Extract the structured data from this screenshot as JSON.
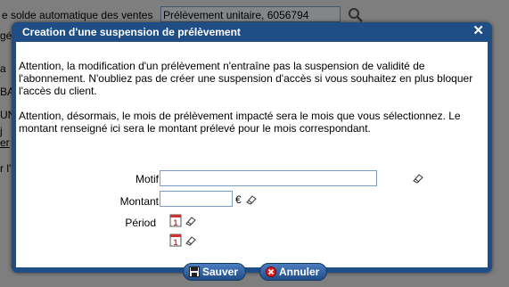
{
  "background": {
    "top_label": "e solde automatique des ventes",
    "top_field_value": "Prélèvement unitaire, 6056794",
    "fragments": [
      "gé",
      "a",
      "BAN",
      "UN",
      "j",
      "er",
      "r l'"
    ]
  },
  "dialog": {
    "title": "Creation d'une suspension de prélèvement",
    "close_label": "✕",
    "paragraph1": "Attention, la modification d'un prélèvement n'entraîne pas la suspension de validité de l'abonnement. N'oubliez pas de créer une suspension d'accès si vous souhaitez en plus bloquer l'accès du client.",
    "paragraph2": "Attention, désormais, le mois de prélèvement impacté sera le mois que vous sélectionnez. Le montant renseigné ici sera le montant prélevé pour le mois correspondant.",
    "form": {
      "motif_label": "Motif",
      "motif_value": "",
      "montant_label": "Montant",
      "montant_value": "",
      "currency": "€",
      "periode_label": "Périod"
    },
    "buttons": {
      "save_label": "Sauver",
      "cancel_label": "Annuler"
    }
  }
}
